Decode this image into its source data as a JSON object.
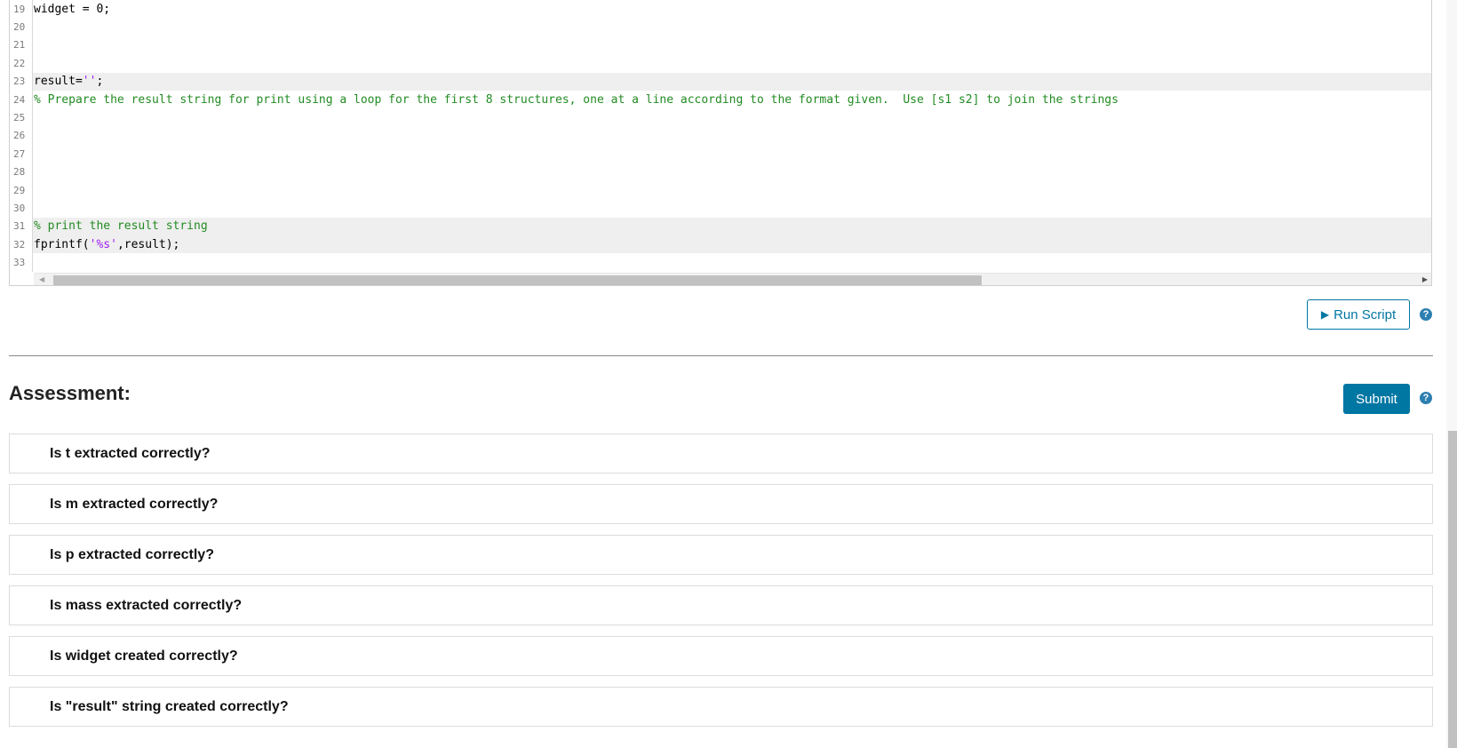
{
  "editor": {
    "lines": [
      {
        "num": "19",
        "tokens": [
          {
            "t": "plain",
            "v": "widget = 0;"
          }
        ],
        "hl": false
      },
      {
        "num": "20",
        "tokens": [],
        "hl": false
      },
      {
        "num": "21",
        "tokens": [],
        "hl": false
      },
      {
        "num": "22",
        "tokens": [],
        "hl": false
      },
      {
        "num": "23",
        "tokens": [
          {
            "t": "plain",
            "v": "result="
          },
          {
            "t": "string",
            "v": "''"
          },
          {
            "t": "plain",
            "v": ";"
          }
        ],
        "hl": true
      },
      {
        "num": "24",
        "tokens": [
          {
            "t": "comment",
            "v": "% Prepare the result string for print using a loop for the first 8 structures, one at a line according to the format given.  Use [s1 s2] to join the strings"
          }
        ],
        "hl": false
      },
      {
        "num": "25",
        "tokens": [],
        "hl": false
      },
      {
        "num": "26",
        "tokens": [],
        "hl": false
      },
      {
        "num": "27",
        "tokens": [],
        "hl": false
      },
      {
        "num": "28",
        "tokens": [],
        "hl": false
      },
      {
        "num": "29",
        "tokens": [],
        "hl": false
      },
      {
        "num": "30",
        "tokens": [],
        "hl": false
      },
      {
        "num": "31",
        "tokens": [
          {
            "t": "comment",
            "v": "% print the result string"
          }
        ],
        "hl": true
      },
      {
        "num": "32",
        "tokens": [
          {
            "t": "plain",
            "v": "fprintf("
          },
          {
            "t": "string",
            "v": "'%s'"
          },
          {
            "t": "plain",
            "v": ",result);"
          }
        ],
        "hl": true
      },
      {
        "num": "33",
        "tokens": [],
        "hl": false
      }
    ]
  },
  "toolbar": {
    "run_label": "Run Script",
    "help_glyph": "?"
  },
  "assessment": {
    "title": "Assessment:",
    "submit_label": "Submit",
    "questions": [
      "Is t extracted correctly?",
      "Is m extracted correctly?",
      "Is p extracted correctly?",
      "Is mass extracted correctly?",
      "Is widget created correctly?",
      "Is \"result\" string created correctly?"
    ]
  },
  "colors": {
    "accent": "#0076a3",
    "comment": "#228b22",
    "string": "#a020f0"
  },
  "icons": {
    "run": "play-icon",
    "help": "help-circle-icon"
  }
}
